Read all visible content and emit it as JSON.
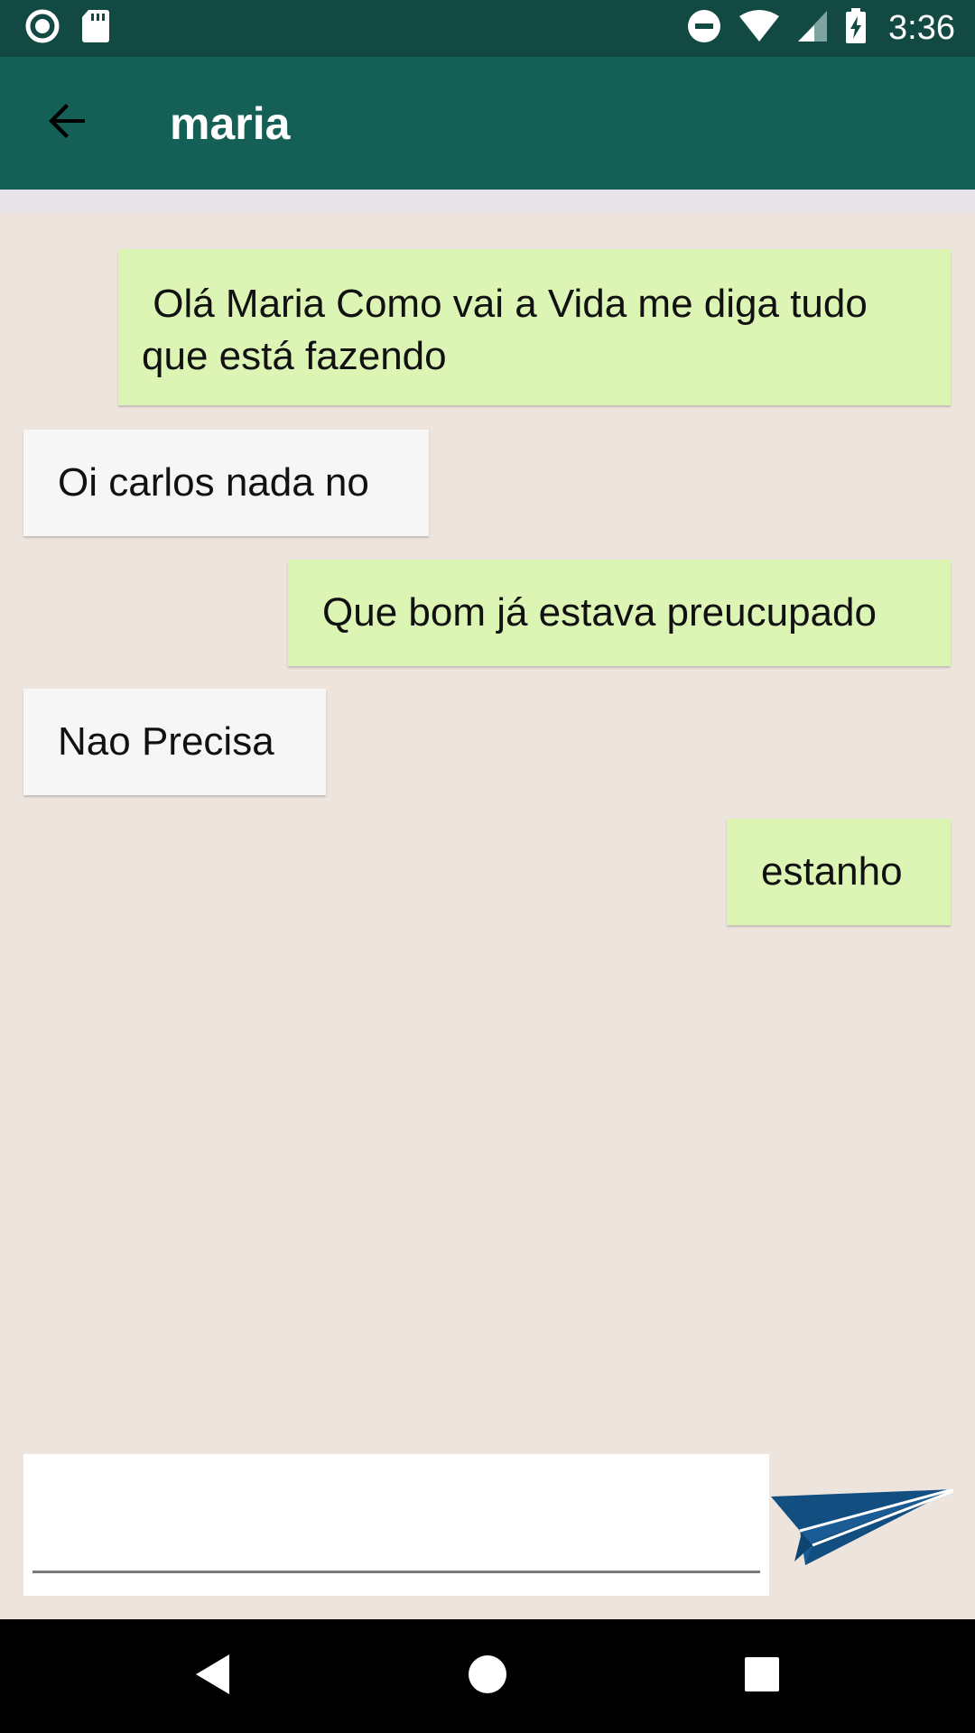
{
  "status_bar": {
    "time": "3:36",
    "icons": [
      "record-icon",
      "sd-card-icon",
      "do-not-disturb-icon",
      "wifi-icon",
      "cell-signal-icon",
      "battery-charging-icon"
    ]
  },
  "app_bar": {
    "title": "maria",
    "back_icon": "arrow-back-icon"
  },
  "messages": [
    {
      "direction": "sent",
      "text": " Olá Maria Como vai a Vida me diga tudo que está fazendo"
    },
    {
      "direction": "received",
      "text": "Oi carlos nada no"
    },
    {
      "direction": "sent",
      "text": "Que bom já estava preucupado"
    },
    {
      "direction": "received",
      "text": "Nao Precisa"
    },
    {
      "direction": "sent",
      "text": "estanho"
    }
  ],
  "composer": {
    "value": "",
    "placeholder": "",
    "send_icon": "paper-plane-icon"
  },
  "nav_bar": {
    "icons": [
      "nav-back-icon",
      "nav-home-icon",
      "nav-recents-icon"
    ]
  },
  "colors": {
    "status_bar": "#124a43",
    "app_bar": "#145f56",
    "chat_background": "#ede4dd",
    "sent_bubble": "#dcf5b5",
    "received_bubble": "#f6f6f6",
    "send_icon": "#124e80"
  }
}
